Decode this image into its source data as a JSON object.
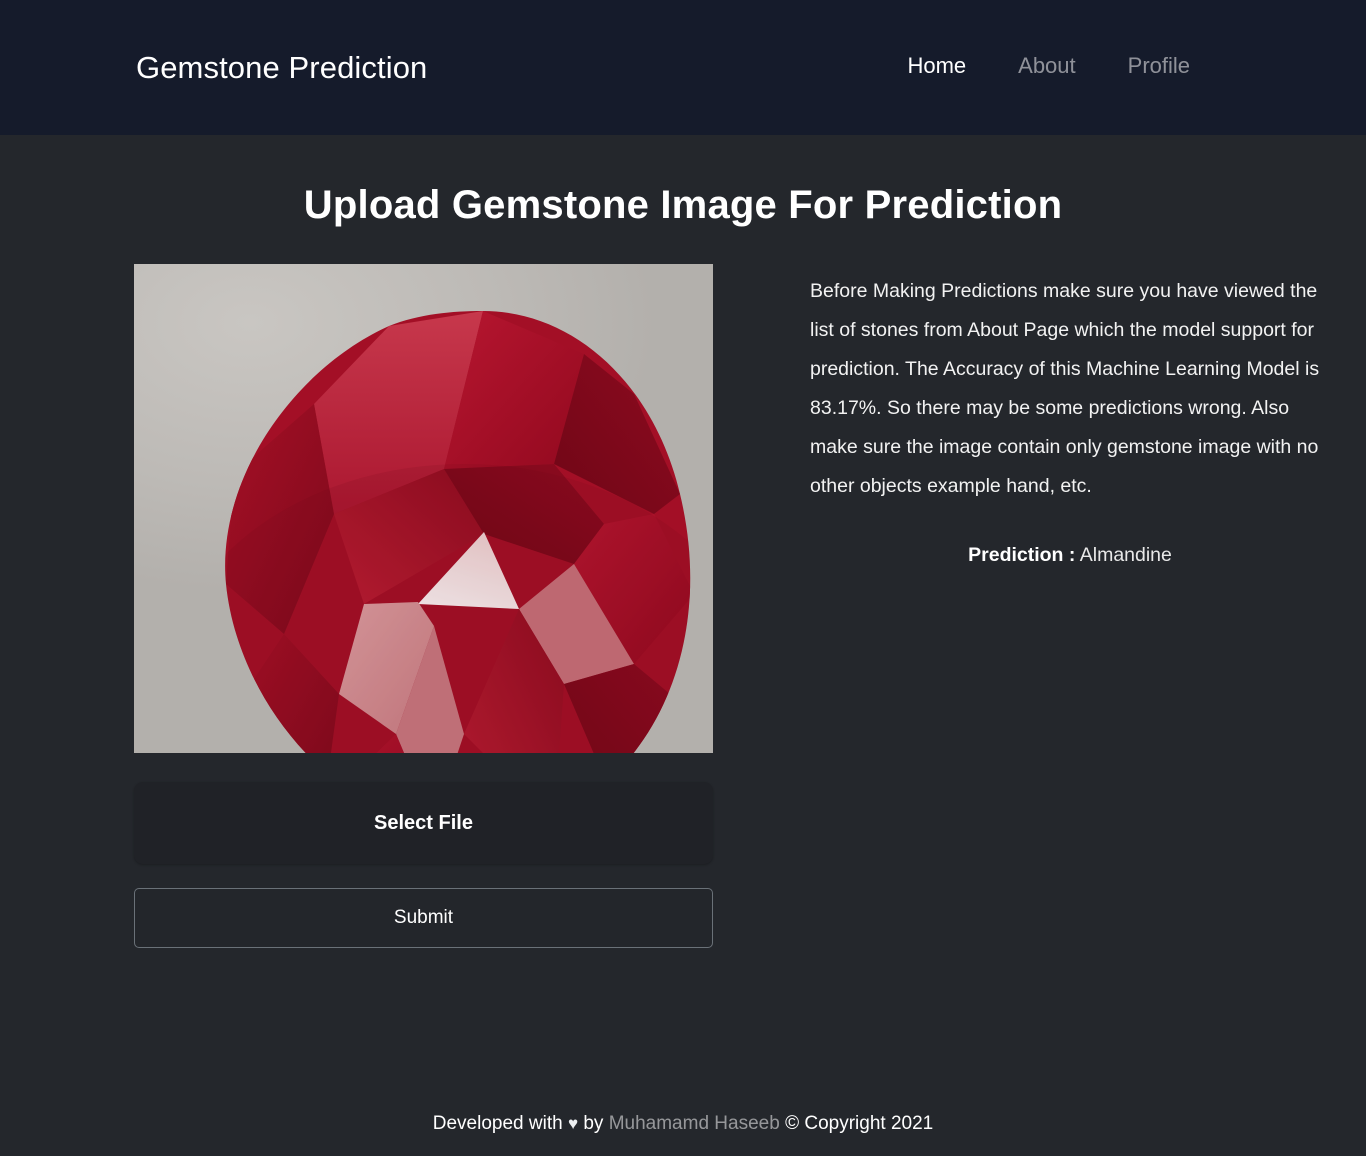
{
  "theme": {
    "navbar_bg": "#151b2b",
    "body_bg": "#24272c",
    "text": "#ffffff",
    "muted_text": "rgba(255,255,255,0.52)",
    "button_border": "#6a7178",
    "gem_color": "#b00d28",
    "gem_background": "#bdbab6"
  },
  "navbar": {
    "brand": "Gemstone Prediction",
    "links": [
      {
        "label": "Home",
        "active": true
      },
      {
        "label": "About",
        "active": false
      },
      {
        "label": "Profile",
        "active": false
      }
    ]
  },
  "main": {
    "title": "Upload Gemstone Image For Prediction",
    "preview": {
      "alt": "Uploaded gemstone image preview",
      "subject": "red faceted pear-cut gemstone on light gray background"
    },
    "buttons": {
      "select_file": "Select File",
      "submit": "Submit"
    },
    "info_paragraph": "Before Making Predictions make sure you have viewed the list of stones from About Page which the model support for prediction. The Accuracy of this Machine Learning Model is 83.17%. So there may be some predictions wrong. Also make sure the image contain only gemstone image with no other objects example hand, etc.",
    "prediction": {
      "label": "Prediction :",
      "value": "Almandine"
    }
  },
  "footer": {
    "prefix": "Developed with",
    "heart": "♥",
    "by": "by",
    "author": "Muhamamd Haseeb",
    "copyright": "© Copyright 2021"
  }
}
